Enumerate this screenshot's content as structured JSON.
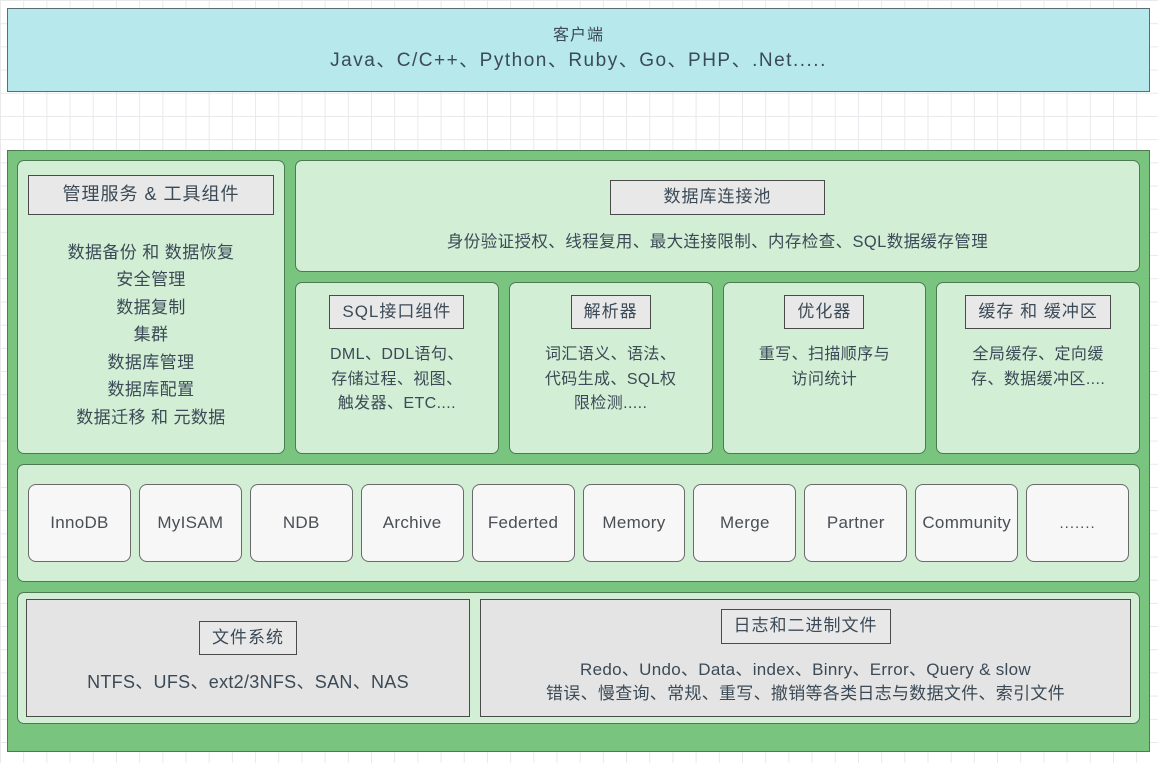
{
  "client_layer": {
    "title": "客户端",
    "languages": "Java、C/C++、Python、Ruby、Go、PHP、.Net....."
  },
  "service_layer": {
    "management": {
      "title": "管理服务 & 工具组件",
      "items": [
        "数据备份 和 数据恢复",
        "安全管理",
        "数据复制",
        "集群",
        "数据库管理",
        "数据库配置",
        "数据迁移 和 元数据"
      ]
    },
    "connection_pool": {
      "title": "数据库连接池",
      "description": "身份验证授权、线程复用、最大连接限制、内存检查、SQL数据缓存管理"
    },
    "components": [
      {
        "title": "SQL接口组件",
        "lines": [
          "DML、DDL语句、",
          "存储过程、视图、",
          "触发器、ETC...."
        ]
      },
      {
        "title": "解析器",
        "lines": [
          "词汇语义、语法、",
          "代码生成、SQL权",
          "限检测....."
        ]
      },
      {
        "title": "优化器",
        "lines": [
          "重写、扫描顺序与",
          "访问统计"
        ]
      },
      {
        "title": "缓存 和 缓冲区",
        "lines": [
          "全局缓存、定向缓",
          "存、数据缓冲区...."
        ]
      }
    ]
  },
  "storage_engine_layer": {
    "engines": [
      "InnoDB",
      "MyISAM",
      "NDB",
      "Archive",
      "Federted",
      "Memory",
      "Merge",
      "Partner",
      "Community",
      "......."
    ]
  },
  "physical_layer": {
    "file_system": {
      "title": "文件系统",
      "description": "NTFS、UFS、ext2/3NFS、SAN、NAS"
    },
    "log_files": {
      "title": "日志和二进制文件",
      "line1": "Redo、Undo、Data、index、Binry、Error、Query & slow",
      "line2": "错误、慢查询、常规、重写、撤销等各类日志与数据文件、索引文件"
    }
  },
  "colors": {
    "client_fill": "#b6e8ec",
    "server_outer": "#79c47f",
    "panel_fill": "#d2eed5",
    "chip_fill": "#e8e8e8",
    "engine_chip_fill": "#f7f7f7",
    "file_box_fill": "#e4e4e4",
    "border_green": "#4e7a52",
    "border_dark": "#4a4a4a",
    "text": "#3b4a56"
  }
}
